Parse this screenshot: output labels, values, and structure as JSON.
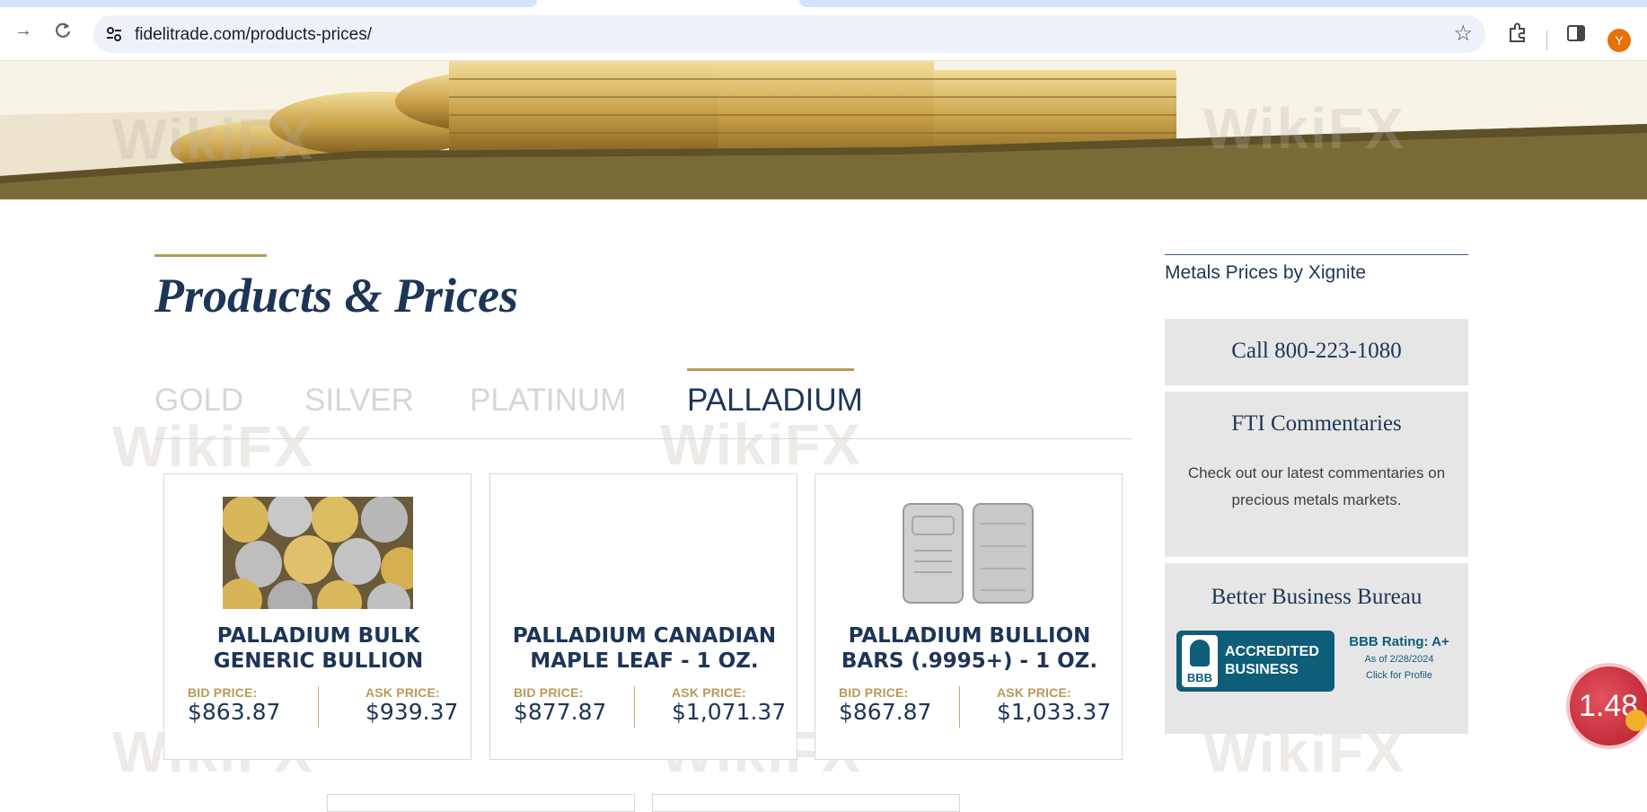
{
  "browser": {
    "url": "fidelitrade.com/products-prices/",
    "avatar_initial": "Y"
  },
  "watermark": "WikiFX",
  "page": {
    "title": "Products & Prices",
    "tabs": [
      {
        "label": "GOLD",
        "active": false
      },
      {
        "label": "SILVER",
        "active": false
      },
      {
        "label": "PLATINUM",
        "active": false
      },
      {
        "label": "PALLADIUM",
        "active": true
      }
    ],
    "bid_label": "BID PRICE:",
    "ask_label": "ASK PRICE:",
    "products": [
      {
        "name": "PALLADIUM BULK GENERIC BULLION",
        "bid": "$863.87",
        "ask": "$939.37"
      },
      {
        "name": "PALLADIUM CANADIAN MAPLE LEAF - 1 OZ.",
        "bid": "$877.87",
        "ask": "$1,071.37"
      },
      {
        "name": "PALLADIUM BULLION BARS (.9995+) - 1 OZ.",
        "bid": "$867.87",
        "ask": "$1,033.37"
      }
    ]
  },
  "sidebar": {
    "title": "Metals Prices by Xignite",
    "call": "Call 800-223-1080",
    "fti_title": "FTI Commentaries",
    "fti_text": "Check out our latest commentaries on precious metals markets.",
    "bbb_title": "Better Business Bureau",
    "bbb": {
      "seal": "BBB",
      "accredited": "ACCREDITED BUSINESS",
      "rating": "BBB Rating: A+",
      "date": "As of 2/28/2024",
      "profile": "Click for Profile"
    }
  },
  "floating_badge": "1.48",
  "colors": {
    "navy": "#1d3557",
    "gold": "#b79a58",
    "panel": "#e6e6e6",
    "bbb": "#0e5e7a"
  }
}
